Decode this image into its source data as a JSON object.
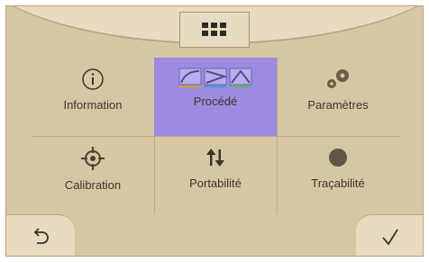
{
  "menu": {
    "items": [
      {
        "label": "Information",
        "icon": "info-icon",
        "selected": false
      },
      {
        "label": "Procédé",
        "icon": "process-curves-icon",
        "selected": true
      },
      {
        "label": "Paramètres",
        "icon": "gears-icon",
        "selected": false
      },
      {
        "label": "Calibration",
        "icon": "crosshair-icon",
        "selected": false
      },
      {
        "label": "Portabilité",
        "icon": "transfer-arrows-icon",
        "selected": false
      },
      {
        "label": "Traçabilité",
        "icon": "dot-icon",
        "selected": false
      }
    ]
  },
  "colors": {
    "background": "#d6c7a4",
    "panel": "#e6dcc2",
    "selected": "#9c8be0",
    "text": "#3b342a"
  }
}
